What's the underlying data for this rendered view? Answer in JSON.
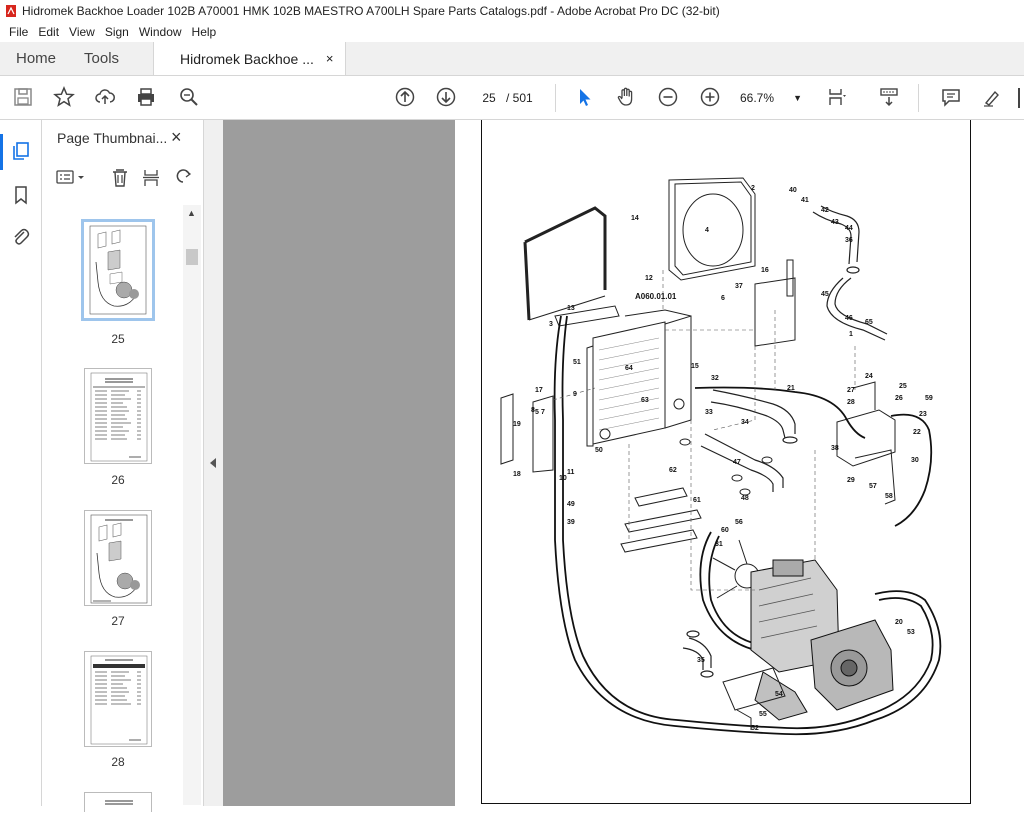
{
  "window": {
    "title": "Hidromek Backhoe Loader 102B A70001 HMK 102B MAESTRO A700LH Spare Parts Catalogs.pdf - Adobe Acrobat Pro DC (32-bit)"
  },
  "menu": [
    "File",
    "Edit",
    "View",
    "Sign",
    "Window",
    "Help"
  ],
  "tabs": {
    "home": "Home",
    "tools": "Tools",
    "document": "Hidromek Backhoe ...",
    "close_glyph": "×"
  },
  "toolbar": {
    "current_page": "25",
    "page_total": "/ 501",
    "zoom": "66.7%"
  },
  "sidebar": {
    "title": "Page Thumbnai...",
    "close_glyph": "×",
    "thumbnails": [
      {
        "page": "25",
        "kind": "drawing",
        "selected": true
      },
      {
        "page": "26",
        "kind": "table",
        "selected": false
      },
      {
        "page": "27",
        "kind": "drawing",
        "selected": false
      },
      {
        "page": "28",
        "kind": "table",
        "selected": false
      }
    ]
  },
  "drawing": {
    "code": "A060.01.01",
    "callouts": [
      "1",
      "2",
      "3",
      "4",
      "5",
      "6",
      "7",
      "8",
      "9",
      "10",
      "11",
      "12",
      "13",
      "14",
      "15",
      "16",
      "17",
      "18",
      "19",
      "20",
      "21",
      "22",
      "23",
      "24",
      "25",
      "26",
      "27",
      "28",
      "29",
      "30",
      "31",
      "32",
      "33",
      "34",
      "35",
      "36",
      "37",
      "38",
      "39",
      "40",
      "41",
      "42",
      "43",
      "44",
      "45",
      "46",
      "47",
      "48",
      "49",
      "50",
      "51",
      "52",
      "53",
      "54",
      "55",
      "56",
      "57",
      "58",
      "59",
      "60",
      "61",
      "62",
      "63",
      "64",
      "65"
    ]
  },
  "colors": {
    "accent": "#1473e6",
    "workspace": "#9d9d9d",
    "thumb_selected": "#9ec5ec"
  }
}
